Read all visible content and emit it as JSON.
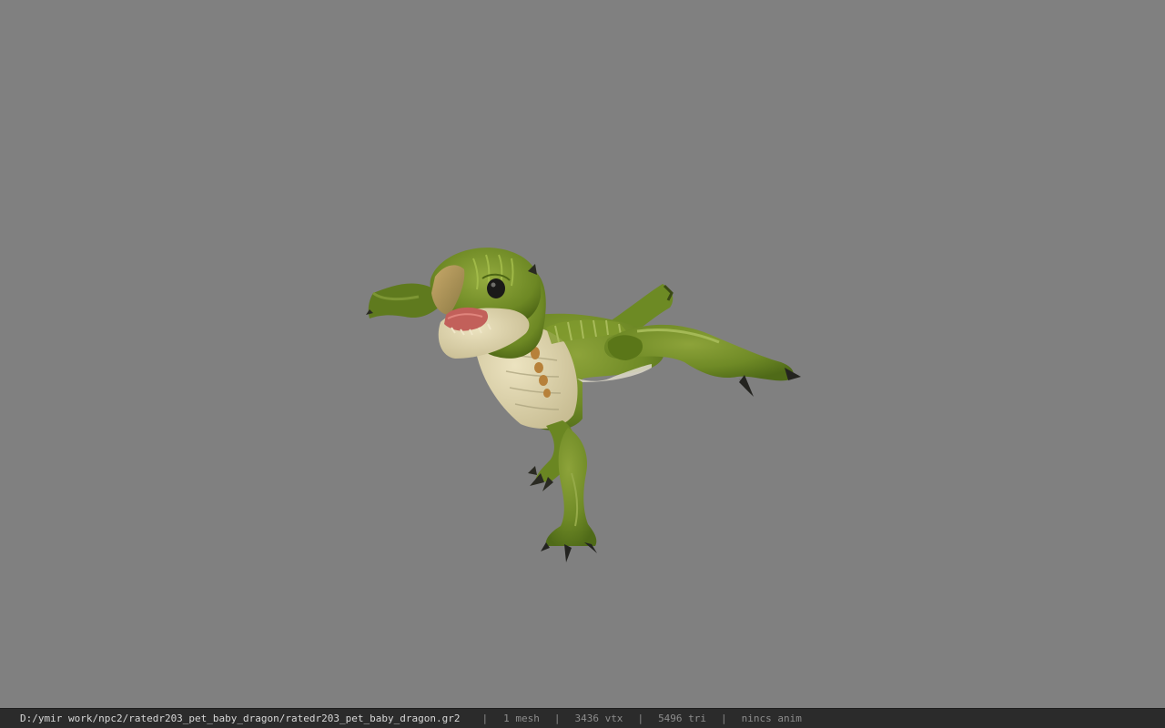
{
  "viewer": {
    "background_color": "#808080",
    "model_subject": "baby dragon pet"
  },
  "status_bar": {
    "file_path": "D:/ymir work/npc2/ratedr203_pet_baby_dragon/ratedr203_pet_baby_dragon.gr2",
    "separator": "|",
    "mesh_count": "1 mesh",
    "vertex_count": "3436 vtx",
    "triangle_count": "5496 tri",
    "anim_status": "nincs anim"
  }
}
